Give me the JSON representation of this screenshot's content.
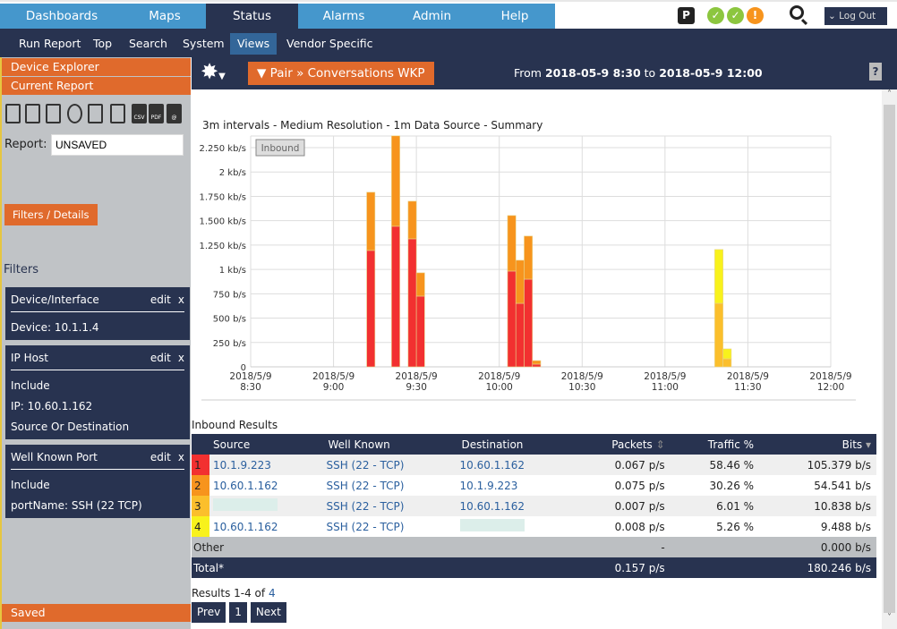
{
  "nav": {
    "tabs": [
      "Dashboards",
      "Maps",
      "Status",
      "Alarms",
      "Admin",
      "Help"
    ],
    "active": "Status",
    "logout": "Log Out",
    "status_icons": [
      "server-p-icon",
      "ok-check-icon",
      "ok-check-icon",
      "warning-icon"
    ]
  },
  "subnav": {
    "items": [
      "Run Report",
      "Top",
      "Search",
      "System",
      "Views",
      "Vendor Specific"
    ],
    "active": "Views"
  },
  "sidebar": {
    "device_explorer": "Device Explorer",
    "current_report": "Current Report",
    "report_label": "Report:",
    "report_value": "UNSAVED",
    "filters_button": "Filters / Details",
    "filters_title": "Filters",
    "saved": "Saved",
    "toolbar_icons": [
      "trash-icon",
      "save-icon",
      "save-as-icon",
      "clock-icon",
      "grid-icon",
      "print-icon",
      "csv-icon",
      "pdf-icon",
      "email-icon"
    ],
    "filters": [
      {
        "title": "Device/Interface",
        "edit": "edit",
        "remove": "x",
        "lines": [
          "Device: 10.1.1.4"
        ]
      },
      {
        "title": "IP Host",
        "edit": "edit",
        "remove": "x",
        "lines": [
          "Include",
          "IP: 10.60.1.162",
          "Source Or Destination"
        ]
      },
      {
        "title": "Well Known Port",
        "edit": "edit",
        "remove": "x",
        "lines": [
          "Include",
          "portName: SSH (22 TCP)"
        ]
      }
    ]
  },
  "header": {
    "report_button": "▼ Pair » Conversations WKP",
    "from": "From",
    "start": "2018-05-9 8:30",
    "to": "to",
    "end": "2018-05-9 12:00",
    "help": "?"
  },
  "chart_data": {
    "type": "bar",
    "stacked": true,
    "title": "3m intervals - Medium Resolution - 1m Data Source - Summary",
    "legend": "Inbound",
    "ylabel": "",
    "ylim": [
      0,
      2250
    ],
    "grid": true,
    "yticks": [
      "0",
      "250 b/s",
      "500 b/s",
      "750 b/s",
      "1 kb/s",
      "1.250 kb/s",
      "1.500 kb/s",
      "1.750 kb/s",
      "2 kb/s",
      "2.250 kb/s"
    ],
    "xticks": [
      "2018/5/9 8:30",
      "2018/5/9 9:00",
      "2018/5/9 9:30",
      "2018/5/9 10:00",
      "2018/5/9 10:30",
      "2018/5/9 11:00",
      "2018/5/9 11:30",
      "2018/5/9 12:00"
    ],
    "colors": [
      "#f23030",
      "#f7941d",
      "#fbbf2c",
      "#f8f21c"
    ],
    "x": [
      "9:12",
      "9:21",
      "9:27",
      "9:30",
      "10:03",
      "10:06",
      "10:09",
      "10:12",
      "11:18",
      "11:21"
    ],
    "series": [
      {
        "values": [
          1195,
          1443,
          1314,
          726,
          983,
          652,
          900,
          28,
          0,
          0
        ]
      },
      {
        "values": [
          597,
          928,
          386,
          239,
          570,
          442,
          442,
          36,
          0,
          0
        ]
      },
      {
        "values": [
          0,
          0,
          0,
          0,
          0,
          0,
          0,
          0,
          652,
          83
        ]
      },
      {
        "values": [
          0,
          0,
          0,
          0,
          0,
          0,
          0,
          0,
          552,
          101
        ]
      }
    ]
  },
  "results": {
    "title": "Inbound Results",
    "columns": [
      "Source",
      "Well Known",
      "Destination",
      "Packets",
      "Traffic %",
      "Bits"
    ],
    "rows": [
      {
        "rank": "1",
        "color": "#f23030",
        "source": "10.1.9.223",
        "wk": "SSH (22 - TCP)",
        "dest": "10.60.1.162",
        "packets": "0.067 p/s",
        "traffic": "58.46 %",
        "bits": "105.379 b/s"
      },
      {
        "rank": "2",
        "color": "#f7941d",
        "source": "10.60.1.162",
        "wk": "SSH (22 - TCP)",
        "dest": "10.1.9.223",
        "packets": "0.075 p/s",
        "traffic": "30.26 %",
        "bits": "54.541 b/s"
      },
      {
        "rank": "3",
        "color": "#fbbf2c",
        "source": "",
        "wk": "SSH (22 - TCP)",
        "dest": "10.60.1.162",
        "packets": "0.007 p/s",
        "traffic": "6.01 %",
        "bits": "10.838 b/s"
      },
      {
        "rank": "4",
        "color": "#f8f21c",
        "source": "10.60.1.162",
        "wk": "SSH (22 - TCP)",
        "dest": "",
        "packets": "0.008 p/s",
        "traffic": "5.26 %",
        "bits": "9.488 b/s"
      }
    ],
    "other": {
      "label": "Other",
      "packets": "-",
      "bits": "0.000 b/s"
    },
    "total": {
      "label": "Total*",
      "packets": "0.157 p/s",
      "bits": "180.246 b/s"
    },
    "summary_prefix": "Results 1-4 of ",
    "summary_count": "4",
    "prev": "Prev",
    "page": "1",
    "next": "Next"
  }
}
